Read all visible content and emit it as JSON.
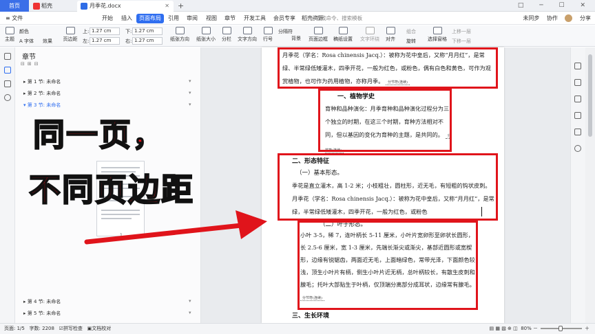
{
  "tabs": {
    "home": "首页",
    "daoke": "稻壳",
    "document": "月季花.docx",
    "add": "+"
  },
  "window_controls": "□ ─ ☐ ✕",
  "menu": {
    "file": "≡ 文件",
    "items": [
      "开始",
      "插入",
      "页面布局",
      "引用",
      "审阅",
      "视图",
      "章节",
      "开发工具",
      "会员专享",
      "稻壳资源"
    ],
    "active": "页面布局",
    "search_placeholder": "查找命令、搜索模板",
    "right": [
      "未同步",
      "协作",
      "分享"
    ]
  },
  "ribbon": {
    "theme": "主题",
    "colors": "颜色",
    "fonts": "A 字体",
    "effects": "效果",
    "page_margin": "页边距",
    "margin_top_label": "上:",
    "margin_top": "1.27 cm",
    "margin_bottom_label": "下:",
    "margin_bottom": "1.27 cm",
    "margin_left_label": "左:",
    "margin_left": "1.27 cm",
    "margin_right_label": "右:",
    "margin_right": "1.27 cm",
    "orientation": "纸张方向",
    "paper_size": "纸张大小",
    "columns": "分栏",
    "text_direction": "文字方向",
    "line_numbers": "行号",
    "breaks": "分隔符",
    "background": "背景",
    "page_border": "页面边框",
    "draft": "稿纸设置",
    "text_wrap": "文字环绕",
    "align": "对齐",
    "rotate": "旋转",
    "group": "组合",
    "select_pane": "选择窗格",
    "bring_forward": "上移一层",
    "send_backward": "下移一层"
  },
  "nav": {
    "title": "章节",
    "sections": [
      {
        "label": "第 1 节: 未命名",
        "current": false
      },
      {
        "label": "第 2 节: 未命名",
        "current": false
      },
      {
        "label": "第 3 节: 未命名",
        "current": true
      },
      {
        "label": "第 4 节: 未命名",
        "current": false
      },
      {
        "label": "第 5 节: 未命名",
        "current": false
      }
    ],
    "thumb_page": "1"
  },
  "overlay": {
    "line1": "同一页，",
    "line2": "不同页边距"
  },
  "document": {
    "p1": "月季花（学名：Rosa chinensis Jacq.）：被称为花中皇后，又称“月月红”，是常绿、半常绿低矮灌木，四季开花，一般为红色，或粉色，偶有白色和黄色，可作为观赏植物，也可作为药用植物，亦称月季。",
    "break1": "分节符(连续)",
    "h1": "一、植物学史",
    "p2": "育种和品种演化：月季育种和品种演化过程分为三个独立的时期，在这三个时期，育种方法相对不同，但以基因的变化为育种的主题，是共同的。",
    "break2": "分节符(连续)",
    "h2": "二、形态特征",
    "h2a": "（一）基本形态。",
    "p3": "季花是直立灌木，高 1-2 米；小枝粗壮，圆柱形，近无毛，有短粗的钩状皮刺。月季花（学名：Rosa chinensis Jacq.）：被称为花中皇后，又称“月月红”，是常绿，半常绿低矮灌木，四季开花，一般为红色，或粉色",
    "h2b": "（二）叶子形态。",
    "p4": "小叶 3-5，稀 7，连叶柄长 5-11 厘米，小叶片宽卵形至卵状长圆形，长 2.5-6 厘米，宽 1-3 厘米，先端长渐尖或渐尖，基部近圆形或宽楔形，边缘有锐锯齿，两面近无毛，上面暗绿色，常带光泽，下面颜色较浅，顶生小叶片有柄，侧生小叶片近无柄，总叶柄较长，有散生皮刺和腺毛；托叶大部贴生于叶柄，仅顶端分离部分成耳状，边缘常有腺毛。",
    "break3": "分节符(连续)",
    "h3": "三、生长环境"
  },
  "status": {
    "page": "页面: 1/5",
    "words": "字数: 2208",
    "spell": "拼写检查",
    "proof": "文档校对",
    "zoom": "80%"
  },
  "colors": {
    "accent": "#2f6ef0",
    "highlight_red": "#e0141b"
  }
}
